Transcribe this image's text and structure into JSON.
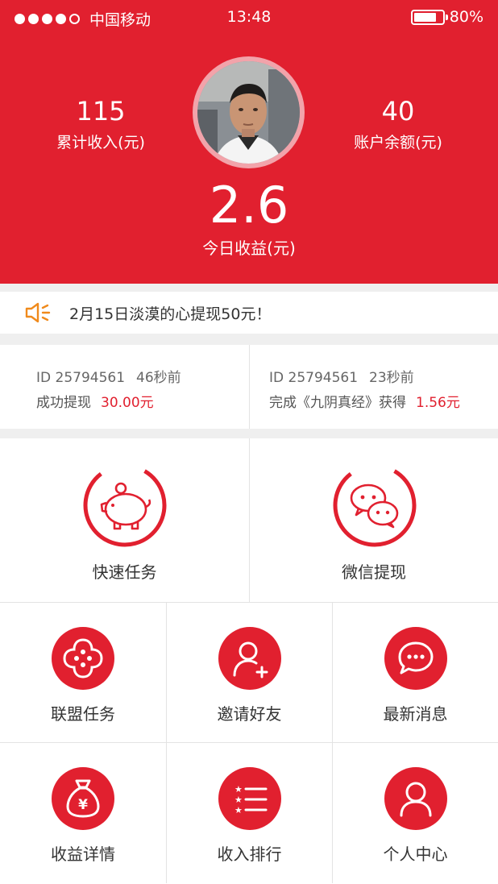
{
  "status_bar": {
    "carrier": "中国移动",
    "time": "13:48",
    "battery": "80%",
    "battery_level": 0.8
  },
  "header": {
    "total_income_value": "115",
    "total_income_label": "累计收入(元)",
    "balance_value": "40",
    "balance_label": "账户余额(元)",
    "today_value": "2.6",
    "today_label": "今日收益(元)"
  },
  "notice": {
    "icon": "megaphone-icon",
    "text": "2月15日淡漠的心提现50元！"
  },
  "records": [
    {
      "id": "ID 25794561",
      "ago": "46秒前",
      "action": "成功提现",
      "amount": "30.00元"
    },
    {
      "id": "ID 25794561",
      "ago": "23秒前",
      "action": "完成《九阴真经》获得",
      "amount": "1.56元"
    }
  ],
  "big_items": [
    {
      "label": "快速任务",
      "icon": "piggy-bank-icon"
    },
    {
      "label": "微信提现",
      "icon": "wechat-icon"
    }
  ],
  "small_items": [
    {
      "label": "联盟任务",
      "icon": "alliance-icon"
    },
    {
      "label": "邀请好友",
      "icon": "add-user-icon"
    },
    {
      "label": "最新消息",
      "icon": "message-icon"
    },
    {
      "label": "收益详情",
      "icon": "money-bag-icon"
    },
    {
      "label": "收入排行",
      "icon": "ranking-list-icon"
    },
    {
      "label": "个人中心",
      "icon": "user-icon"
    }
  ],
  "colors": {
    "accent": "#e1202f",
    "notice_icon": "#f08a1c"
  }
}
